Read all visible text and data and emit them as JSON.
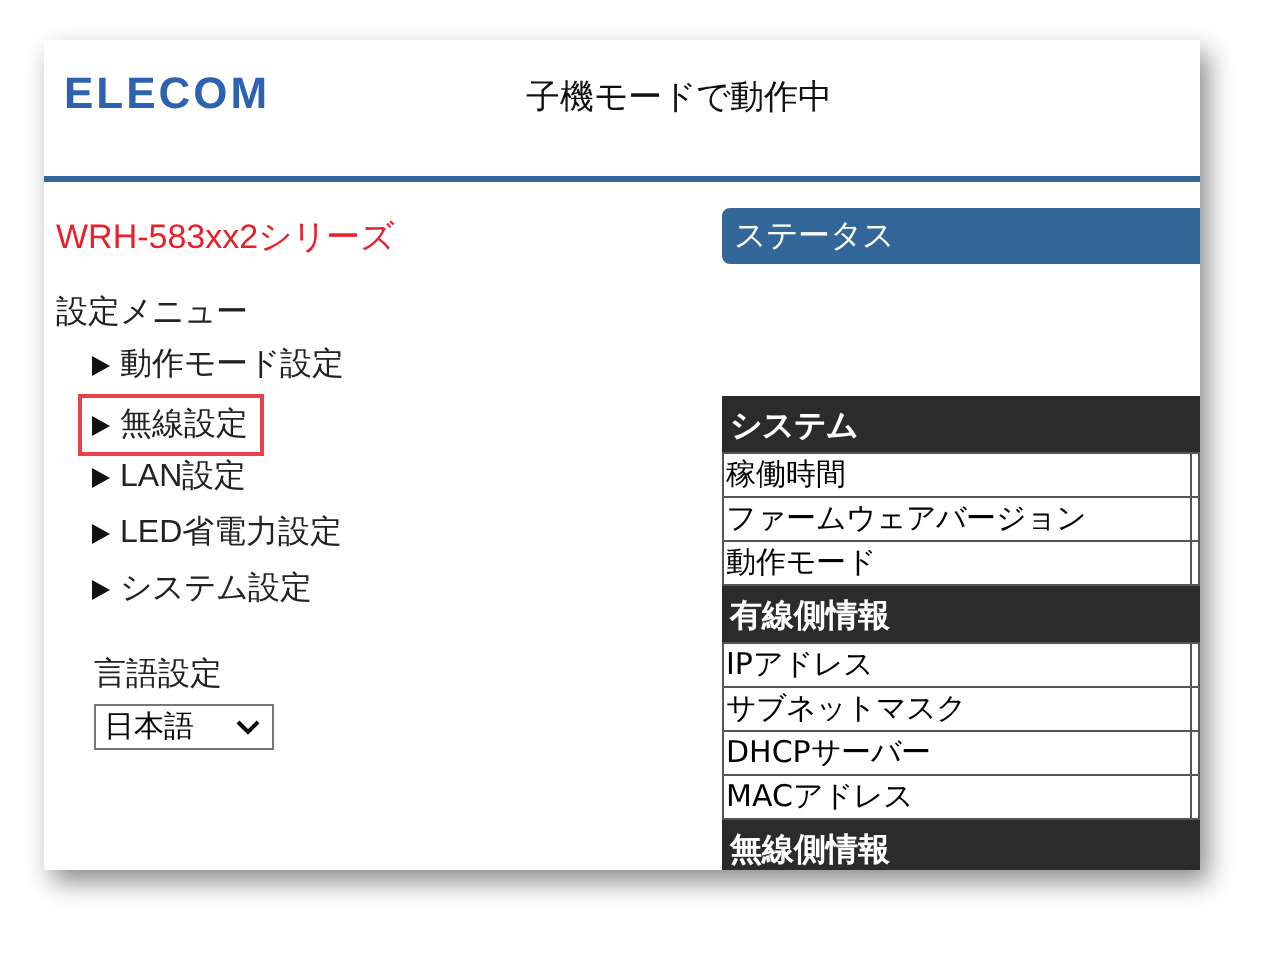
{
  "header": {
    "logo": "ELECOM",
    "status_text": "子機モードで動作中"
  },
  "sidebar": {
    "series": "WRH-583xx2シリーズ",
    "menu_title": "設定メニュー",
    "items": [
      {
        "label": "動作モード設定",
        "selected": false
      },
      {
        "label": "無線設定",
        "selected": true
      },
      {
        "label": "LAN設定",
        "selected": false
      },
      {
        "label": "LED省電力設定",
        "selected": false
      },
      {
        "label": "システム設定",
        "selected": false
      }
    ],
    "language_label": "言語設定",
    "language_value": "日本語"
  },
  "main": {
    "heading": "ステータス",
    "table": [
      {
        "kind": "section",
        "label": "システム"
      },
      {
        "kind": "row",
        "label": "稼働時間"
      },
      {
        "kind": "row",
        "label": "ファームウェアバージョン"
      },
      {
        "kind": "row",
        "label": "動作モード"
      },
      {
        "kind": "section",
        "label": "有線側情報"
      },
      {
        "kind": "row",
        "label": "IPアドレス"
      },
      {
        "kind": "row",
        "label": "サブネットマスク"
      },
      {
        "kind": "row",
        "label": "DHCPサーバー"
      },
      {
        "kind": "row",
        "label": "MACアドレス"
      },
      {
        "kind": "section",
        "label": "無線側情報"
      }
    ]
  }
}
